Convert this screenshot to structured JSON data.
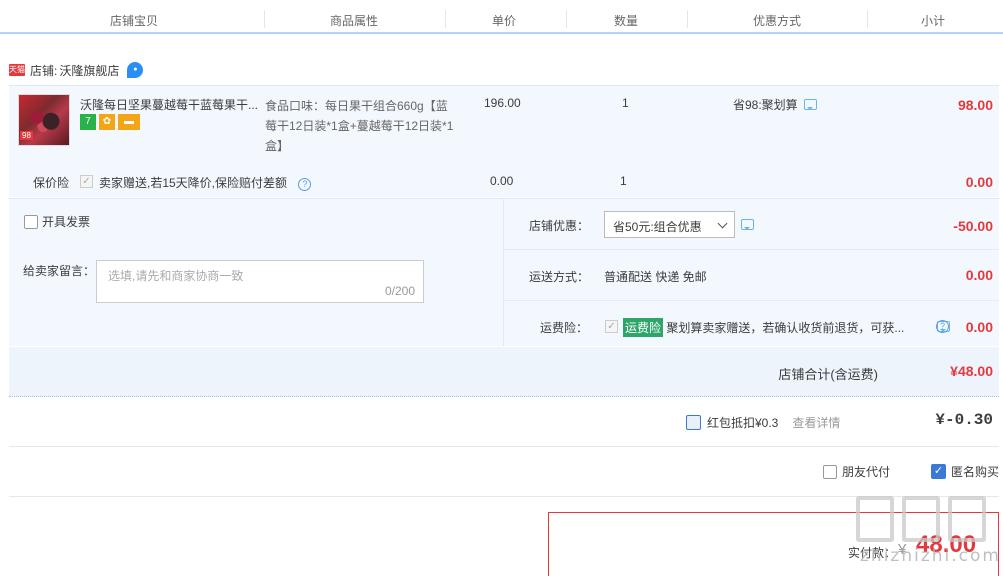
{
  "header": {
    "columns": [
      "店铺宝贝",
      "商品属性",
      "单价",
      "数量",
      "优惠方式",
      "小计"
    ]
  },
  "shop": {
    "badge": "天猫",
    "label": "店铺:",
    "name": "沃隆旗舰店"
  },
  "item": {
    "title": "沃隆每日坚果蔓越莓干蓝莓果干...",
    "thumb_tag": "98",
    "attribute": "食品口味：每日果干组合660g【蓝莓干12日装*1盒+蔓越莓干12日装*1盒】",
    "price": "196.00",
    "quantity": "1",
    "promotion": "省98:聚划算",
    "subtotal": "98.00"
  },
  "insurance": {
    "label": "保价险",
    "text": "卖家赠送,若15天降价,保险赔付差额",
    "price": "0.00",
    "quantity": "1",
    "subtotal": "0.00"
  },
  "invoice": {
    "label": "开具发票"
  },
  "message": {
    "label": "给卖家留言：",
    "placeholder": "选填,请先和商家协商一致",
    "counter": "0/200"
  },
  "shop_discount": {
    "label": "店铺优惠：",
    "selected": "省50元:组合优惠",
    "amount": "-50.00"
  },
  "shipping": {
    "label": "运送方式：",
    "method": "普通配送 快递 免邮",
    "amount": "0.00"
  },
  "shipping_insurance": {
    "label": "运费险：",
    "tag": "运费险",
    "text": "聚划算卖家赠送，若确认收货前退货，可获...",
    "amount": "0.00"
  },
  "shop_total": {
    "label": "店铺合计(含运费)",
    "amount": "¥48.00"
  },
  "red_packet": {
    "label": "红包抵扣¥0.3",
    "link": "查看详情",
    "amount": "¥-0.30"
  },
  "options": {
    "friend_pay": "朋友代付",
    "anonymous": "匿名购买"
  },
  "payment": {
    "label": "实付款：",
    "currency": "¥",
    "amount": "48.00"
  },
  "watermark": {
    "text": "zhizhizhi.com"
  },
  "colors": {
    "accent_red": "#e4393c",
    "light_blue_bg": "#f3f8ff",
    "checkbox_blue": "#3a79d6",
    "tag_green": "#2ea66a"
  }
}
